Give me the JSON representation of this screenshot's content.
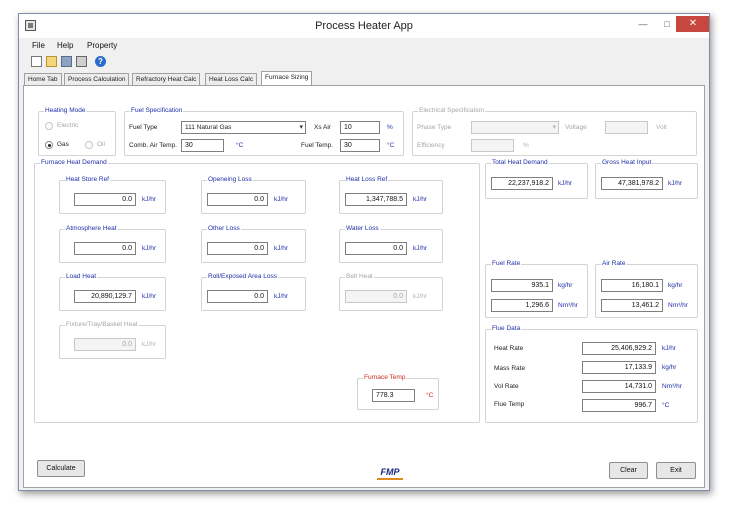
{
  "app": {
    "title": "Process Heater App"
  },
  "window_controls": {
    "minimize": "—",
    "maximize": "□",
    "close": "✕"
  },
  "menu": {
    "file": "File",
    "help": "Help",
    "property": "Property"
  },
  "toolbar": {
    "new_icon": "new-document-icon",
    "open_icon": "open-folder-icon",
    "save_icon": "save-icon",
    "print_icon": "print-icon",
    "help_icon": "?"
  },
  "tabs": [
    {
      "label": "Home Tab",
      "active": false
    },
    {
      "label": "Process Calculation",
      "active": false
    },
    {
      "label": "Refractory Heat Calc",
      "active": false
    },
    {
      "label": "Heat Loss Calc",
      "active": false
    },
    {
      "label": "Furnace Sizing",
      "active": true
    }
  ],
  "heating_mode": {
    "title": "Heating Mode",
    "electric": "Electric",
    "gas": "Gas",
    "oil": "Oil",
    "selected": "Gas"
  },
  "fuel_spec": {
    "title": "Fuel Specification",
    "fuel_type_label": "Fuel Type",
    "fuel_type_value": "111 Natural Gas",
    "xs_air_label": "Xs Air",
    "xs_air_value": "10",
    "xs_air_unit": "%",
    "comb_air_label": "Comb. Air Temp.",
    "comb_air_value": "30",
    "comb_air_unit": "°C",
    "fuel_temp_label": "Fuel Temp.",
    "fuel_temp_value": "30",
    "fuel_temp_unit": "°C"
  },
  "electrical_spec": {
    "title": "Electrical Specification",
    "phase_type_label": "Phase Type",
    "voltage_label": "Voltage",
    "voltage_unit": "Volt",
    "efficiency_label": "Efficiency",
    "efficiency_unit": "%"
  },
  "furnace_heat_demand": {
    "title": "Furnace Heat Demand",
    "heat_store_ref": {
      "label": "Heat Store Ref",
      "value": "0.0",
      "unit": "kJ/hr"
    },
    "openeing_loss": {
      "label": "Openeing Loss",
      "value": "0.0",
      "unit": "kJ/hr"
    },
    "heat_loss_ref": {
      "label": "Heat Loss Ref",
      "value": "1,347,788.5",
      "unit": "kJ/hr"
    },
    "atmosphere_heat": {
      "label": "Atmosphere Heat",
      "value": "0.0",
      "unit": "kJ/hr"
    },
    "other_loss": {
      "label": "Other Loss",
      "value": "0.0",
      "unit": "kJ/hr"
    },
    "water_loss": {
      "label": "Water Loss",
      "value": "0.0",
      "unit": "kJ/hr"
    },
    "load_heat": {
      "label": "Load Heat",
      "value": "20,890,129.7",
      "unit": "kJ/hr"
    },
    "roll_exposed": {
      "label": "Roll/Exposed Area Loss",
      "value": "0.0",
      "unit": "kJ/hr"
    },
    "belt_heat": {
      "label": "Belt Heat",
      "value": "0.0",
      "unit": "kJ/hr"
    },
    "fixture": {
      "label": "Fixture/Tray/Basket Heat",
      "value": "0.0",
      "unit": "kJ/hr"
    },
    "furnace_temp": {
      "label": "Furnace Temp",
      "value": "778.3",
      "unit": "°C"
    }
  },
  "total_heat_demand": {
    "title": "Total Heat Demand",
    "value": "22,237,918.2",
    "unit": "kJ/hr"
  },
  "gross_heat_input": {
    "title": "Gross Heat Input",
    "value": "47,381,978.2",
    "unit": "kJ/hr"
  },
  "fuel_rate": {
    "title": "Fuel Rate",
    "mass_value": "935.1",
    "mass_unit": "kg/hr",
    "vol_value": "1,296.6",
    "vol_unit": "Nm³/hr"
  },
  "air_rate": {
    "title": "Air Rate",
    "mass_value": "16,180.1",
    "mass_unit": "kg/hr",
    "vol_value": "13,461.2",
    "vol_unit": "Nm³/hr"
  },
  "flue_data": {
    "title": "Flue Data",
    "heat_rate_label": "Heat Rate",
    "heat_rate_value": "25,406,929.2",
    "heat_rate_unit": "kJ/hr",
    "mass_rate_label": "Mass Rate",
    "mass_rate_value": "17,133.9",
    "mass_rate_unit": "kg/hr",
    "vol_rate_label": "Vol Rate",
    "vol_rate_value": "14,731.0",
    "vol_rate_unit": "Nm³/hr",
    "flue_temp_label": "Flue Temp",
    "flue_temp_value": "996.7",
    "flue_temp_unit": "°C"
  },
  "buttons": {
    "calculate": "Calculate",
    "clear": "Clear",
    "exit": "Exit"
  },
  "logo": {
    "text": "FMP"
  }
}
